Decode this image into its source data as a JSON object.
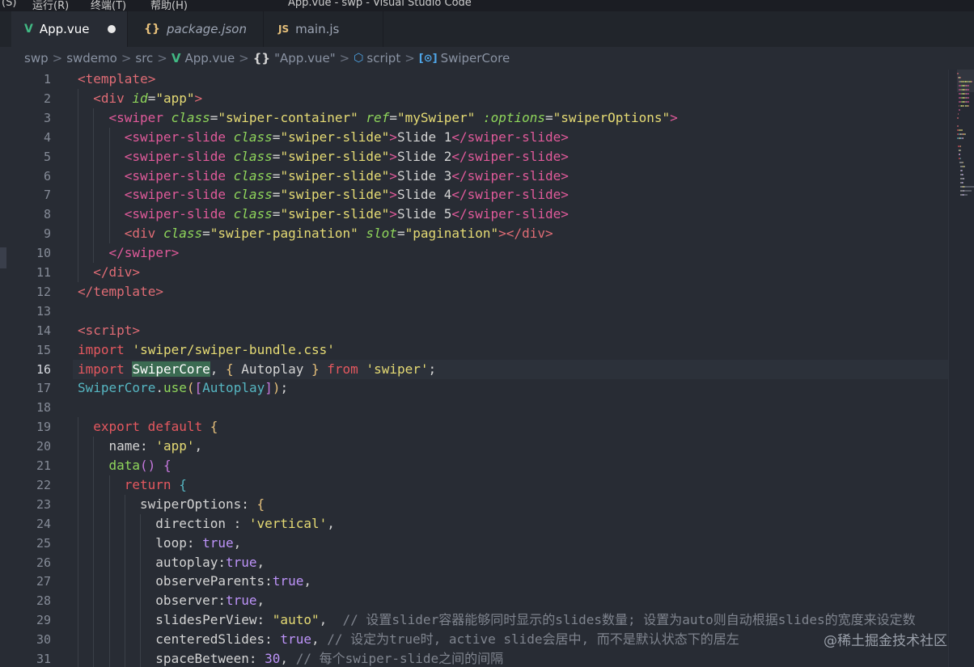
{
  "window": {
    "menus": [
      "(S)",
      "运行(R)",
      "终端(T)",
      "帮助(H)"
    ],
    "title": "App.vue - swp - Visual Studio Code"
  },
  "tabs": [
    {
      "label": "App.vue",
      "icon": "vue-icon",
      "icon_glyph": "V",
      "icon_color": "#41b883",
      "active": true,
      "dirty": true,
      "italic": false
    },
    {
      "label": "package.json",
      "icon": "json-icon",
      "icon_glyph": "{}",
      "icon_color": "#e6c07b",
      "active": false,
      "dirty": false,
      "italic": true
    },
    {
      "label": "main.js",
      "icon": "js-icon",
      "icon_glyph": "JS",
      "icon_color": "#e6c07b",
      "active": false,
      "dirty": false,
      "italic": false
    }
  ],
  "breadcrumb": {
    "items": [
      "swp",
      "swdemo",
      "src",
      "App.vue",
      "\"App.vue\"",
      "script",
      "SwiperCore"
    ],
    "separator": ">"
  },
  "editor": {
    "current_line": 16,
    "lines": [
      {
        "n": "1",
        "indent": 0,
        "tokens": [
          [
            "tag",
            "<template>"
          ]
        ]
      },
      {
        "n": "2",
        "indent": 1,
        "tokens": [
          [
            "tag",
            "<div "
          ],
          [
            "attr",
            "id"
          ],
          [
            "pun",
            "="
          ],
          [
            "str",
            "\"app\""
          ],
          [
            "tag",
            ">"
          ]
        ]
      },
      {
        "n": "3",
        "indent": 2,
        "tokens": [
          [
            "tag2",
            "<swiper "
          ],
          [
            "attr",
            "class"
          ],
          [
            "pun",
            "="
          ],
          [
            "str",
            "\"swiper-container\" "
          ],
          [
            "attr",
            "ref"
          ],
          [
            "pun",
            "="
          ],
          [
            "str",
            "\"mySwiper\" "
          ],
          [
            "attr",
            ":options"
          ],
          [
            "pun",
            "="
          ],
          [
            "str",
            "\"swiperOptions\""
          ],
          [
            "tag2",
            ">"
          ]
        ]
      },
      {
        "n": "4",
        "indent": 3,
        "tokens": [
          [
            "tag2",
            "<swiper-slide "
          ],
          [
            "attr",
            "class"
          ],
          [
            "pun",
            "="
          ],
          [
            "str",
            "\"swiper-slide\""
          ],
          [
            "tag2",
            ">"
          ],
          [
            "txt",
            "Slide 1"
          ],
          [
            "tag2",
            "</swiper-slide>"
          ]
        ]
      },
      {
        "n": "5",
        "indent": 3,
        "tokens": [
          [
            "tag2",
            "<swiper-slide "
          ],
          [
            "attr",
            "class"
          ],
          [
            "pun",
            "="
          ],
          [
            "str",
            "\"swiper-slide\""
          ],
          [
            "tag2",
            ">"
          ],
          [
            "txt",
            "Slide 2"
          ],
          [
            "tag2",
            "</swiper-slide>"
          ]
        ]
      },
      {
        "n": "6",
        "indent": 3,
        "tokens": [
          [
            "tag2",
            "<swiper-slide "
          ],
          [
            "attr",
            "class"
          ],
          [
            "pun",
            "="
          ],
          [
            "str",
            "\"swiper-slide\""
          ],
          [
            "tag2",
            ">"
          ],
          [
            "txt",
            "Slide 3"
          ],
          [
            "tag2",
            "</swiper-slide>"
          ]
        ]
      },
      {
        "n": "7",
        "indent": 3,
        "tokens": [
          [
            "tag2",
            "<swiper-slide "
          ],
          [
            "attr",
            "class"
          ],
          [
            "pun",
            "="
          ],
          [
            "str",
            "\"swiper-slide\""
          ],
          [
            "tag2",
            ">"
          ],
          [
            "txt",
            "Slide 4"
          ],
          [
            "tag2",
            "</swiper-slide>"
          ]
        ]
      },
      {
        "n": "8",
        "indent": 3,
        "tokens": [
          [
            "tag2",
            "<swiper-slide "
          ],
          [
            "attr",
            "class"
          ],
          [
            "pun",
            "="
          ],
          [
            "str",
            "\"swiper-slide\""
          ],
          [
            "tag2",
            ">"
          ],
          [
            "txt",
            "Slide 5"
          ],
          [
            "tag2",
            "</swiper-slide>"
          ]
        ]
      },
      {
        "n": "9",
        "indent": 3,
        "tokens": [
          [
            "tag",
            "<div "
          ],
          [
            "attr",
            "class"
          ],
          [
            "pun",
            "="
          ],
          [
            "str",
            "\"swiper-pagination\" "
          ],
          [
            "attr",
            "slot"
          ],
          [
            "pun",
            "="
          ],
          [
            "str",
            "\"pagination\""
          ],
          [
            "tag",
            "></div>"
          ]
        ]
      },
      {
        "n": "10",
        "indent": 2,
        "tokens": [
          [
            "tag2",
            "</swiper>"
          ]
        ]
      },
      {
        "n": "11",
        "indent": 1,
        "tokens": [
          [
            "tag",
            "</div>"
          ]
        ]
      },
      {
        "n": "12",
        "indent": 0,
        "tokens": [
          [
            "tag",
            "</template>"
          ]
        ]
      },
      {
        "n": "13",
        "indent": 0,
        "tokens": []
      },
      {
        "n": "14",
        "indent": 0,
        "tokens": [
          [
            "tag",
            "<script>"
          ]
        ]
      },
      {
        "n": "15",
        "indent": 0,
        "tokens": [
          [
            "kw",
            "import "
          ],
          [
            "str",
            "'swiper/swiper-bundle.css'"
          ]
        ]
      },
      {
        "n": "16",
        "indent": 0,
        "tokens": [
          [
            "kw",
            "import "
          ],
          [
            "sel",
            "SwiperCore"
          ],
          [
            "pun",
            ", "
          ],
          [
            "brace",
            "{ "
          ],
          [
            "prop",
            "Autoplay "
          ],
          [
            "brace",
            "} "
          ],
          [
            "kw",
            "from "
          ],
          [
            "str",
            "'swiper'"
          ],
          [
            "pun",
            ";"
          ]
        ]
      },
      {
        "n": "17",
        "indent": 0,
        "tokens": [
          [
            "cls",
            "SwiperCore"
          ],
          [
            "pun",
            "."
          ],
          [
            "fn",
            "use"
          ],
          [
            "brace",
            "("
          ],
          [
            "brace2",
            "["
          ],
          [
            "cls",
            "Autoplay"
          ],
          [
            "brace2",
            "]"
          ],
          [
            "brace",
            ")"
          ],
          [
            "pun",
            ";"
          ]
        ]
      },
      {
        "n": "18",
        "indent": 0,
        "tokens": []
      },
      {
        "n": "19",
        "indent": 1,
        "tokens": [
          [
            "kw",
            "export default "
          ],
          [
            "brace",
            "{"
          ]
        ]
      },
      {
        "n": "20",
        "indent": 2,
        "tokens": [
          [
            "prop",
            "name"
          ],
          [
            "pun",
            ": "
          ],
          [
            "str",
            "'app'"
          ],
          [
            "pun",
            ","
          ]
        ]
      },
      {
        "n": "21",
        "indent": 2,
        "tokens": [
          [
            "fn",
            "data"
          ],
          [
            "brace2",
            "()"
          ],
          [
            "pun",
            " "
          ],
          [
            "brace2",
            "{"
          ]
        ]
      },
      {
        "n": "22",
        "indent": 3,
        "tokens": [
          [
            "kw",
            "return "
          ],
          [
            "cls",
            "{"
          ]
        ]
      },
      {
        "n": "23",
        "indent": 4,
        "tokens": [
          [
            "prop",
            "swiperOptions"
          ],
          [
            "pun",
            ": "
          ],
          [
            "brace",
            "{"
          ]
        ]
      },
      {
        "n": "24",
        "indent": 5,
        "tokens": [
          [
            "prop",
            "direction "
          ],
          [
            "pun",
            ": "
          ],
          [
            "str",
            "'vertical'"
          ],
          [
            "pun",
            ","
          ]
        ]
      },
      {
        "n": "25",
        "indent": 5,
        "tokens": [
          [
            "prop",
            "loop"
          ],
          [
            "pun",
            ": "
          ],
          [
            "bool",
            "true"
          ],
          [
            "pun",
            ","
          ]
        ]
      },
      {
        "n": "26",
        "indent": 5,
        "tokens": [
          [
            "prop",
            "autoplay"
          ],
          [
            "pun",
            ":"
          ],
          [
            "bool",
            "true"
          ],
          [
            "pun",
            ","
          ]
        ]
      },
      {
        "n": "27",
        "indent": 5,
        "tokens": [
          [
            "prop",
            "observeParents"
          ],
          [
            "pun",
            ":"
          ],
          [
            "bool",
            "true"
          ],
          [
            "pun",
            ","
          ]
        ]
      },
      {
        "n": "28",
        "indent": 5,
        "tokens": [
          [
            "prop",
            "observer"
          ],
          [
            "pun",
            ":"
          ],
          [
            "bool",
            "true"
          ],
          [
            "pun",
            ","
          ]
        ]
      },
      {
        "n": "29",
        "indent": 5,
        "tokens": [
          [
            "prop",
            "slidesPerView"
          ],
          [
            "pun",
            ": "
          ],
          [
            "str",
            "\"auto\""
          ],
          [
            "pun",
            ",  "
          ],
          [
            "cmt",
            "// 设置slider容器能够同时显示的slides数量; 设置为auto则自动根据slides的宽度来设定数"
          ]
        ]
      },
      {
        "n": "30",
        "indent": 5,
        "tokens": [
          [
            "prop",
            "centeredSlides"
          ],
          [
            "pun",
            ": "
          ],
          [
            "bool",
            "true"
          ],
          [
            "pun",
            ", "
          ],
          [
            "cmt",
            "// 设定为true时, active slide会居中, 而不是默认状态下的居左"
          ]
        ]
      },
      {
        "n": "31",
        "indent": 5,
        "tokens": [
          [
            "prop",
            "spaceBetween"
          ],
          [
            "pun",
            ": "
          ],
          [
            "num",
            "30"
          ],
          [
            "pun",
            ", "
          ],
          [
            "cmt",
            "// 每个swiper-slide之间的间隔"
          ]
        ]
      }
    ]
  },
  "watermark": "@稀土掘金技术社区"
}
